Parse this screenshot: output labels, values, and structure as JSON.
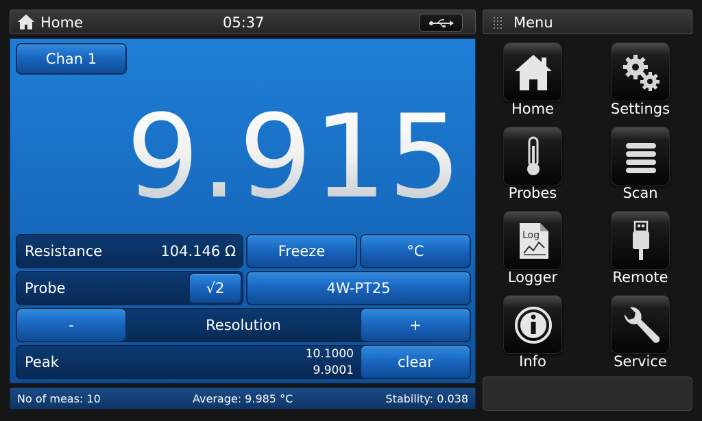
{
  "topbar": {
    "title": "Home",
    "time": "05:37"
  },
  "menubar": {
    "title": "Menu"
  },
  "channel": {
    "label": "Chan 1"
  },
  "reading": {
    "value": "9.915"
  },
  "measure": {
    "label": "Resistance",
    "value": "104.146 Ω",
    "freeze_label": "Freeze",
    "unit_label": "°C"
  },
  "probe": {
    "label": "Probe",
    "sqrt_label": "√2",
    "type_label": "4W-PT25"
  },
  "resolution": {
    "minus_label": "-",
    "label": "Resolution",
    "plus_label": "+"
  },
  "peak": {
    "label": "Peak",
    "max": "10.1000",
    "min": "9.9001",
    "clear_label": "clear"
  },
  "status": {
    "meas": "No of meas: 10",
    "average": "Average: 9.985 °C",
    "stability": "Stability: 0.038"
  },
  "menu_items": [
    {
      "label": "Home",
      "icon": "home-icon"
    },
    {
      "label": "Settings",
      "icon": "gears-icon"
    },
    {
      "label": "Probes",
      "icon": "thermometer-icon"
    },
    {
      "label": "Scan",
      "icon": "list-icon"
    },
    {
      "label": "Logger",
      "icon": "log-icon",
      "icon_text": "Log"
    },
    {
      "label": "Remote",
      "icon": "usb-plug-icon"
    },
    {
      "label": "Info",
      "icon": "info-icon"
    },
    {
      "label": "Service",
      "icon": "wrench-icon"
    }
  ]
}
